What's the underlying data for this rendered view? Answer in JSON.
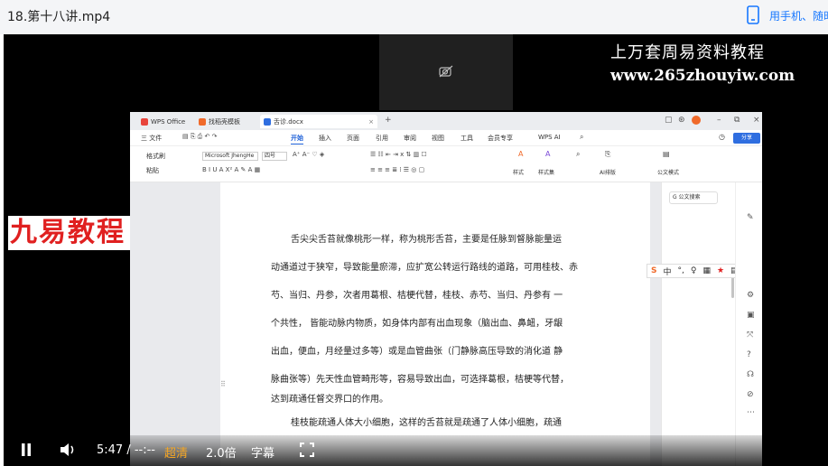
{
  "header": {
    "title": "18.第十八讲.mp4",
    "mobile_link": "用手机、随时"
  },
  "watermark": {
    "line1": "上万套周易资料教程",
    "line2": "www.265zhouyiw.com"
  },
  "brand_stamp": "九易教程",
  "wps": {
    "tabs": [
      "WPS Office",
      "找稻壳模板",
      "舌诊.docx"
    ],
    "menus": [
      "三 文件",
      "开始",
      "插入",
      "页面",
      "引用",
      "审阅",
      "视图",
      "工具",
      "会员专享",
      "WPS AI"
    ],
    "active_menu": "开始",
    "share_label": "分享",
    "ribbon": {
      "format_painter": "格式刷",
      "paste": "粘贴",
      "font_name": "Microsoft JhengHe",
      "font_size": "四号",
      "styles": "样式",
      "style_set": "样式集",
      "ai_layout": "AI排版",
      "official_doc": "公文模式"
    },
    "doc_search": "G 公文搜索",
    "paragraphs": [
      "舌尖尖舌苔就像桃形一样，称为桃形舌苔，主要是任脉到督脉能量运",
      "动通道过于狭窄，导致能量瘀滞，应扩宽公转运行路线的道路，可用桂枝、赤",
      "芍、当归、丹参，次者用葛根、桔梗代替，桂枝、赤芍、当归、丹参有  一",
      "个共性， 皆能动脉内物质，如身体内部有出血现象（脑出血、鼻衄，牙龈",
      "出血，便血，月经量过多等）或是血管曲张（门静脉高压导致的消化道  静",
      "脉曲张等）先天性血管畸形等，容易导致出血，可选择葛根，桔梗等代替，",
      "达到疏通任督交界口的作用。",
      "桂枝能疏通人体大小细胞，这样的舌苔就是疏通了人体小细胞，疏通"
    ],
    "ime_bar": [
      "S",
      "中",
      "°,",
      "♀",
      "▦",
      "★",
      "▤",
      "✎"
    ]
  },
  "player": {
    "time": "5:47 / --:--",
    "quality": "超清",
    "speed": "2.0倍",
    "subtitles": "字幕"
  },
  "colors": {
    "accent": "#1677ff",
    "wps_blue": "#1e60d8",
    "quality_orange": "#f5a623",
    "stamp_red": "#e02020"
  }
}
